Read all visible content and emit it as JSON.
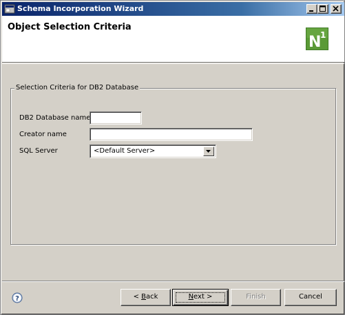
{
  "window": {
    "title": "Schema Incorporation Wizard"
  },
  "header": {
    "title": "Object Selection Criteria",
    "logo_text": "N",
    "logo_superscript": "1"
  },
  "group": {
    "legend": "Selection Criteria for DB2 Database",
    "fields": {
      "db_name_label": "DB2 Database name",
      "db_name_value": "",
      "creator_label": "Creator name",
      "creator_value": "",
      "sql_server_label": "SQL Server",
      "sql_server_value": "<Default Server>"
    }
  },
  "footer": {
    "back_prefix": "< ",
    "back_mnemonic": "B",
    "back_rest": "ack",
    "next_mnemonic": "N",
    "next_rest": "ext >",
    "finish_label": "Finish",
    "cancel_label": "Cancel"
  },
  "colors": {
    "titlebar_start": "#0a246a",
    "titlebar_end": "#a6caf0",
    "window_face": "#d4d0c8",
    "logo_green": "#4e8a2f"
  },
  "icons": {
    "app": "window-app-icon",
    "help": "help-icon",
    "dropdown": "chevron-down-icon"
  }
}
